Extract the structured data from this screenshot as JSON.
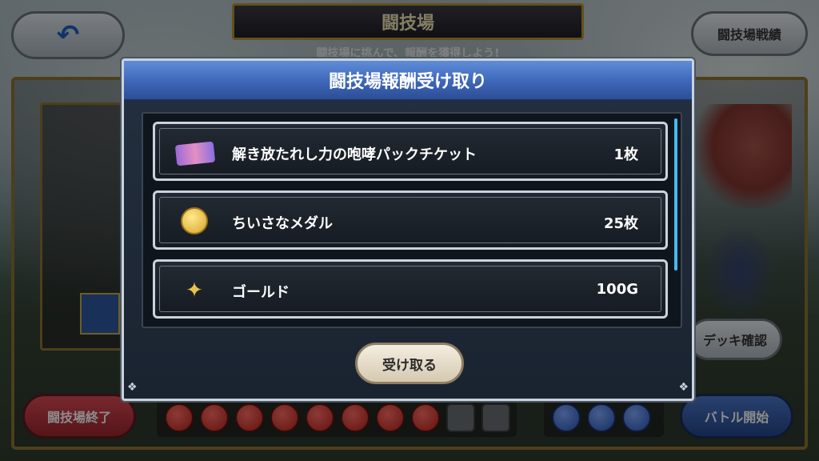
{
  "screen": {
    "title": "闘技場",
    "subtitle": "闘技場に挑んで、報酬を獲得しよう!",
    "back_icon": "back-arrow-icon",
    "record_button": "闘技場戦績",
    "deck_button": "デッキ確認",
    "end_button": "闘技場終了",
    "start_button": "バトル開始"
  },
  "modal": {
    "title": "闘技場報酬受け取り",
    "rewards": [
      {
        "icon": "ticket-icon",
        "name": "解き放たれし力の咆哮パックチケット",
        "quantity": "1枚"
      },
      {
        "icon": "medal-icon",
        "name": "ちいさなメダル",
        "quantity": "25枚"
      },
      {
        "icon": "gold-icon",
        "name": "ゴールド",
        "quantity": "100G"
      }
    ],
    "receive_button": "受け取る"
  },
  "colors": {
    "modal_header": "#3d66b8",
    "end_button": "#c13a43",
    "start_button": "#3560b0",
    "scrollbar": "#47b9f0"
  }
}
